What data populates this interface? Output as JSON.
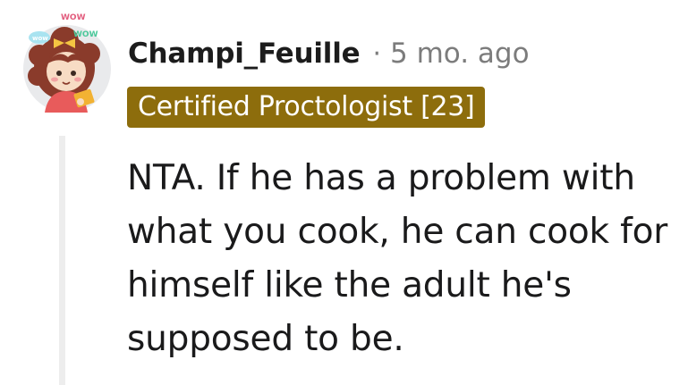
{
  "comment": {
    "username": "Champi_Feuille",
    "separator": "·",
    "timestamp": "5 mo. ago",
    "flair": "Certified Proctologist [23]",
    "flair_color": "#8d6d0c",
    "body_lines": [
      "NTA. If he has a problem with",
      "what you cook, he can cook for",
      "himself like the adult he's",
      "supposed to be."
    ]
  },
  "avatar": {
    "icon": "cartoon-girl-avatar",
    "badges": [
      "wow",
      "wow"
    ]
  }
}
